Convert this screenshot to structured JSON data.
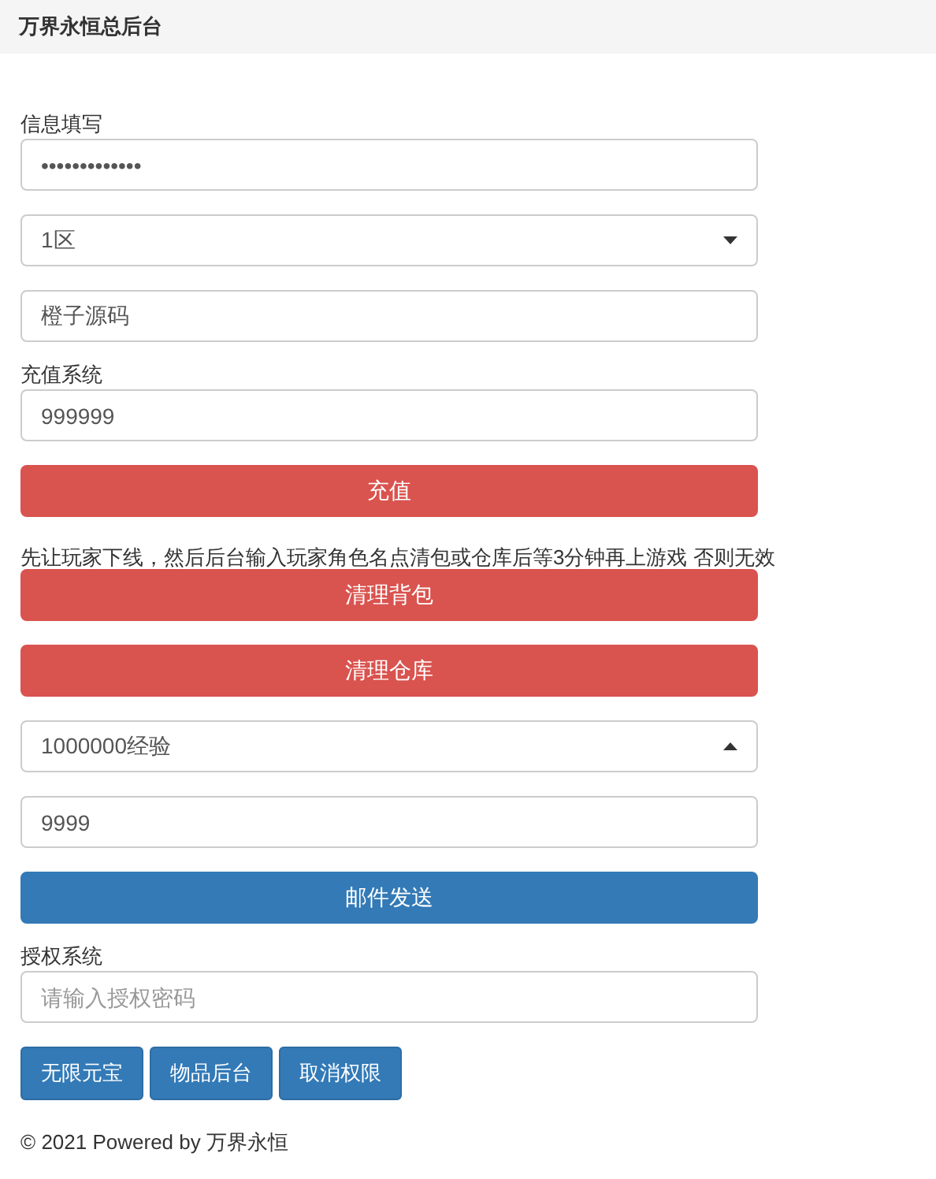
{
  "header": {
    "title": "万界永恒总后台"
  },
  "sections": [
    {
      "kind": "label",
      "text": "信息填写"
    },
    {
      "kind": "input",
      "value": "•••••••••••••"
    },
    {
      "kind": "select",
      "value": "1区",
      "expanded": false
    },
    {
      "kind": "input",
      "value": "橙子源码"
    },
    {
      "kind": "label",
      "text": "充值系统"
    },
    {
      "kind": "input",
      "value": "999999"
    },
    {
      "kind": "button",
      "text": "充值",
      "color": "#d9534f"
    },
    {
      "kind": "note",
      "text": "先让玩家下线，然后后台输入玩家角色名点清包或仓库后等3分钟再上游戏 否则无效"
    },
    {
      "kind": "button",
      "text": "清理背包",
      "color": "#d9534f"
    },
    {
      "kind": "button",
      "text": "清理仓库",
      "color": "#d9534f"
    },
    {
      "kind": "select",
      "value": "1000000经验",
      "expanded": true
    },
    {
      "kind": "input",
      "value": "9999"
    },
    {
      "kind": "button",
      "text": "邮件发送",
      "color": "#337ab7"
    },
    {
      "kind": "label",
      "text": "授权系统"
    },
    {
      "kind": "input",
      "placeholder": "请输入授权密码"
    },
    {
      "kind": "buttons",
      "items": [
        "无限元宝",
        "物品后台",
        "取消权限"
      ]
    }
  ],
  "footer": "© 2021 Powered by 万界永恒"
}
